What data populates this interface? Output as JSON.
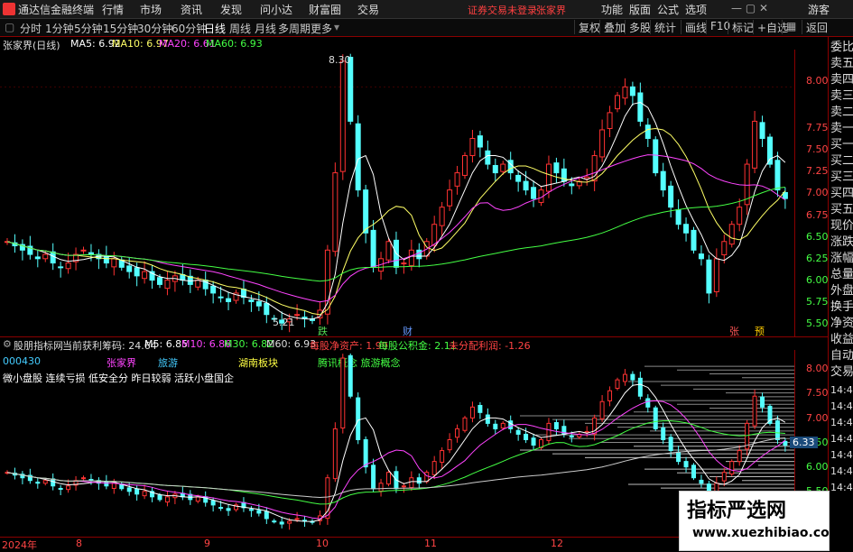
{
  "app_title": "通达信金融终端",
  "menu": [
    "行情",
    "市场",
    "资讯",
    "发现",
    "问小达",
    "财富圈",
    "交易"
  ],
  "login_status": "证券交易未登录",
  "stock_name_top": "张家界",
  "right_menu": [
    "功能",
    "版面",
    "公式",
    "选项"
  ],
  "guest": "游客",
  "periods": [
    "分时",
    "1分钟",
    "5分钟",
    "15分钟",
    "30分钟",
    "60分钟",
    "日线",
    "周线",
    "月线",
    "多周期",
    "更多"
  ],
  "active_period": "日线",
  "toolbar_right": [
    "复权",
    "叠加",
    "多股",
    "统计",
    "画线",
    "F10",
    "标记",
    "+自选",
    "返回"
  ],
  "main_legend": {
    "title": "张家界(日线)",
    "ma5": "MA5: 6.92",
    "ma10": "MA10: 6.97",
    "ma20": "MA20: 6.61",
    "ma60": "MA60: 6.93"
  },
  "main_axis": [
    "8.00",
    "7.75",
    "7.50",
    "7.25",
    "7.00",
    "6.75",
    "6.50",
    "6.25",
    "6.00",
    "5.75",
    "5.50"
  ],
  "annotations": {
    "high": "8.30",
    "low": "5.21"
  },
  "event_marks": [
    {
      "text": "跌",
      "color": "#55dd55"
    },
    {
      "text": "财",
      "color": "#6699ff"
    },
    {
      "text": "张",
      "color": "#ff5555"
    },
    {
      "text": "预",
      "color": "#ffcc00"
    }
  ],
  "lower_legend": {
    "indicator": "股朋指标网",
    "profit": "当前获利筹码: 24.64",
    "m5": "M5: 6.85",
    "m10": "M10: 6.86",
    "m30": "M30: 6.82",
    "m60": "M60: 6.93",
    "bps": "每股净资产: 1.99",
    "reserve": "每股公积金: 2.11",
    "undist": "未分配利润: -1.26"
  },
  "info_row": {
    "code": "000430",
    "name": "张家界",
    "industry": "旅游",
    "region": "湖南板块",
    "concept": "腾讯概念 旅游概念"
  },
  "tags": "微小盘股 连续亏损 低安全分 昨日较弱 活跃小盘国企",
  "lower_axis": [
    "8.00",
    "7.50",
    "7.00",
    "6.50",
    "6.00",
    "5.50"
  ],
  "price_badge": "6.33",
  "date_axis": [
    "2024年",
    "8",
    "9",
    "10",
    "11",
    "12"
  ],
  "right_panel": [
    "委比",
    "卖五",
    "卖四",
    "卖三",
    "卖二",
    "卖一",
    "买一",
    "买二",
    "买三",
    "买四",
    "买五",
    "现价",
    "涨跌",
    "涨幅",
    "总量",
    "外盘",
    "换手",
    "净资",
    "收益",
    "自动",
    "交易",
    "14:48",
    "14:48",
    "14:48",
    "14:48",
    "14:48",
    "14:48",
    "14:48"
  ],
  "watermark": {
    "line1": "指标严选网",
    "line2": "www.xuezhibiao.com"
  },
  "chart_data": {
    "type": "candlestick",
    "closes": [
      6.2,
      6.15,
      6.1,
      6.05,
      6.0,
      6.05,
      5.95,
      5.9,
      5.95,
      6.05,
      6.1,
      6.05,
      6.0,
      5.95,
      6.0,
      5.9,
      5.85,
      5.8,
      5.85,
      5.75,
      5.7,
      5.75,
      5.8,
      5.75,
      5.7,
      5.75,
      5.65,
      5.6,
      5.55,
      5.5,
      5.6,
      5.55,
      5.5,
      5.45,
      5.35,
      5.3,
      5.25,
      5.3,
      5.35,
      5.3,
      5.28,
      5.4,
      6.1,
      7.0,
      8.3,
      7.6,
      6.8,
      6.3,
      5.9,
      6.0,
      6.2,
      5.9,
      5.95,
      6.1,
      6.0,
      6.2,
      6.4,
      6.6,
      6.8,
      7.0,
      7.2,
      7.4,
      7.3,
      7.1,
      7.0,
      7.1,
      7.0,
      6.9,
      6.8,
      6.7,
      6.8,
      7.1,
      7.0,
      6.9,
      6.85,
      6.9,
      6.95,
      7.2,
      7.5,
      7.7,
      7.9,
      8.0,
      7.9,
      7.6,
      7.4,
      7.0,
      6.8,
      6.6,
      6.4,
      6.3,
      6.1,
      6.0,
      5.6,
      6.0,
      6.2,
      6.4,
      6.6,
      7.1,
      7.6,
      7.4,
      7.1,
      6.8,
      6.7
    ],
    "y_range": [
      5.2,
      8.35
    ]
  }
}
